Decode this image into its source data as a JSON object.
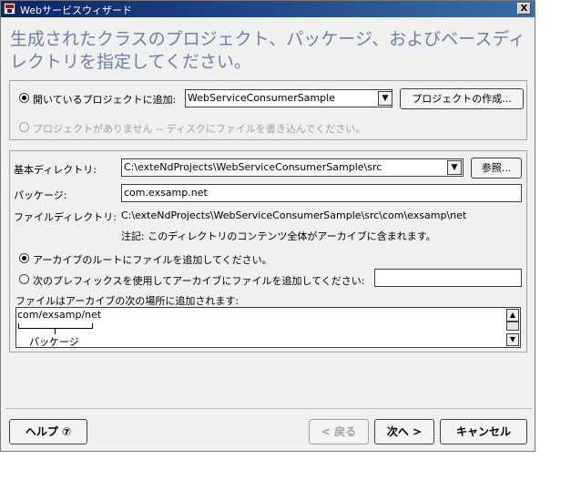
{
  "window": {
    "title": "Webサービスウィザード",
    "close_label": "X"
  },
  "heading": "生成されたクラスのプロジェクト、パッケージ、およびベースディレクトリを指定してください。",
  "project_group": {
    "add_open_project_label": "開いているプロジェクトに追加:",
    "project_value": "WebServiceConsumerSample",
    "create_project_button": "プロジェクトの作成...",
    "no_project_label": "プロジェクトがありません -- ディスクにファイルを書き込んでください。"
  },
  "details": {
    "base_dir_label": "基本ディレクトリ:",
    "base_dir_value": "C:\\exteNdProjects\\WebServiceConsumerSample\\src",
    "browse_button": "参照...",
    "package_label": "パッケージ:",
    "package_value": "com.exsamp.net",
    "file_dir_label": "ファイルディレクトリ:",
    "file_dir_value": "C:\\exteNdProjects\\WebServiceConsumerSample\\src\\com\\exsamp\\net",
    "note": "注記: このディレクトリのコンテンツ全体がアーカイブに含まれます。",
    "archive_root_label": "アーカイブのルートにファイルを追加してください。",
    "prefix_label": "次のプレフィックスを使用してアーカイブにファイルを追加してください:",
    "prefix_value": "",
    "location_label": "ファイルはアーカイブの次の場所に追加されます:",
    "preview_path": "com/exsamp/net",
    "preview_package_label": "パッケージ"
  },
  "footer": {
    "help_button": "ヘルプ ⑦",
    "back_button": "< 戻る",
    "next_button": "次へ >",
    "cancel_button": "キャンセル"
  },
  "colors": {
    "heading": "#6d7fa6",
    "titlebar": "#0a246a"
  },
  "icons": {
    "app": "wizard-app-icon",
    "close": "close-icon",
    "dropdown": "chevron-down-icon",
    "scroll_up": "scroll-up-icon",
    "scroll_down": "scroll-down-icon",
    "help": "help-circle-icon"
  }
}
